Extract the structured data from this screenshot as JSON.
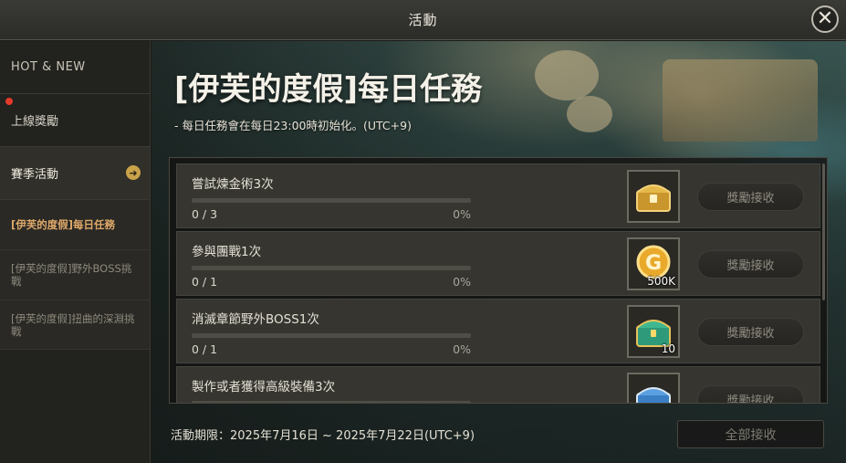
{
  "window": {
    "title": "活動",
    "close_symbol": "✕"
  },
  "sidebar": {
    "categories": [
      {
        "label": "HOT & NEW"
      },
      {
        "label": "上線獎勵",
        "has_alert": true
      },
      {
        "label": "賽季活動",
        "expanded": true
      }
    ],
    "sub_items": [
      {
        "label": "[伊芙的度假]每日任務",
        "active": true
      },
      {
        "label": "[伊芙的度假]野外BOSS挑戰",
        "active": false
      },
      {
        "label": "[伊芙的度假]扭曲的深淵挑戰",
        "active": false
      }
    ]
  },
  "main": {
    "title": "[伊芙的度假]每日任務",
    "subtitle": "- 每日任務會在每日23:00時初始化。(UTC+9)",
    "tasks": [
      {
        "name": "嘗試煉金術3次",
        "progress_text": "0 / 3",
        "percent_text": "0%",
        "progress": 0,
        "reward_icon": "golden-chest-icon",
        "reward_qty": "",
        "claim_label": "獎勵接收"
      },
      {
        "name": "參與團戰1次",
        "progress_text": "0 / 1",
        "percent_text": "0%",
        "progress": 0,
        "reward_icon": "gold-coin-icon",
        "reward_qty": "500K",
        "claim_label": "獎勵接收"
      },
      {
        "name": "消滅章節野外BOSS1次",
        "progress_text": "0 / 1",
        "percent_text": "0%",
        "progress": 0,
        "reward_icon": "green-chest-icon",
        "reward_qty": "10",
        "claim_label": "獎勵接收"
      },
      {
        "name": "製作或者獲得高級裝備3次",
        "progress_text": "",
        "percent_text": "",
        "progress": 0,
        "reward_icon": "blue-chest-icon",
        "reward_qty": "",
        "claim_label": "獎勵接收"
      }
    ],
    "period": "活動期限：2025年7月16日 ~ 2025年7月22日(UTC+9)",
    "claim_all_label": "全部接收"
  },
  "colors": {
    "accent": "#d7a84a",
    "active_sub": "#e0a96a",
    "alert": "#e53a2a"
  }
}
